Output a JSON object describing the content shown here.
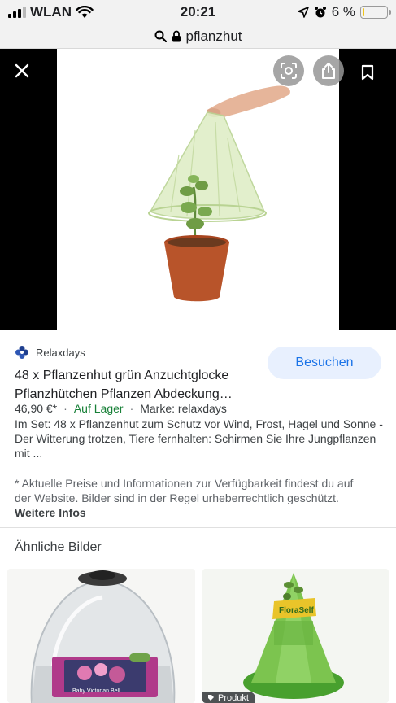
{
  "status_bar": {
    "carrier": "WLAN",
    "time": "20:21",
    "battery_percent": "6 %",
    "battery_level": 0.06
  },
  "url_bar": {
    "query": "pflanzhut"
  },
  "viewer": {
    "close_icon": "close-icon",
    "lens_icon": "lens-icon",
    "share_icon": "share-icon",
    "bookmark_icon": "bookmark-icon"
  },
  "result": {
    "source": "Relaxdays",
    "visit_label": "Besuchen",
    "title_line1": "48 x Pflanzenhut grün Anzuchtglocke",
    "title_line2": "Pflanzhütchen Pflanzen Abdeckung…",
    "price": "46,90 €*",
    "stock": "Auf Lager",
    "brand": "Marke: relaxdays",
    "description": "Im Set: 48 x Pflanzenhut zum Schutz vor Wind, Frost, Hagel und Sonne - Der Witterung trotzen, Tiere fernhalten: Schirmen Sie Ihre Jungpflanzen mit ...",
    "notice": "* Aktuelle Preise und Informationen zur Verfügbarkeit findest du auf der Website. Bilder sind in der Regel urheberrechtlich geschützt.",
    "more_info": "Weitere Infos"
  },
  "similar": {
    "heading": "Ähnliche Bilder",
    "thumb1_brand": "Baby Victorian Bell",
    "thumb2_brand": "FloraSelf",
    "product_chip": "Produkt"
  },
  "colors": {
    "accent": "#1a73e8",
    "in_stock": "#188038",
    "visit_bg": "#e8f0fe"
  }
}
